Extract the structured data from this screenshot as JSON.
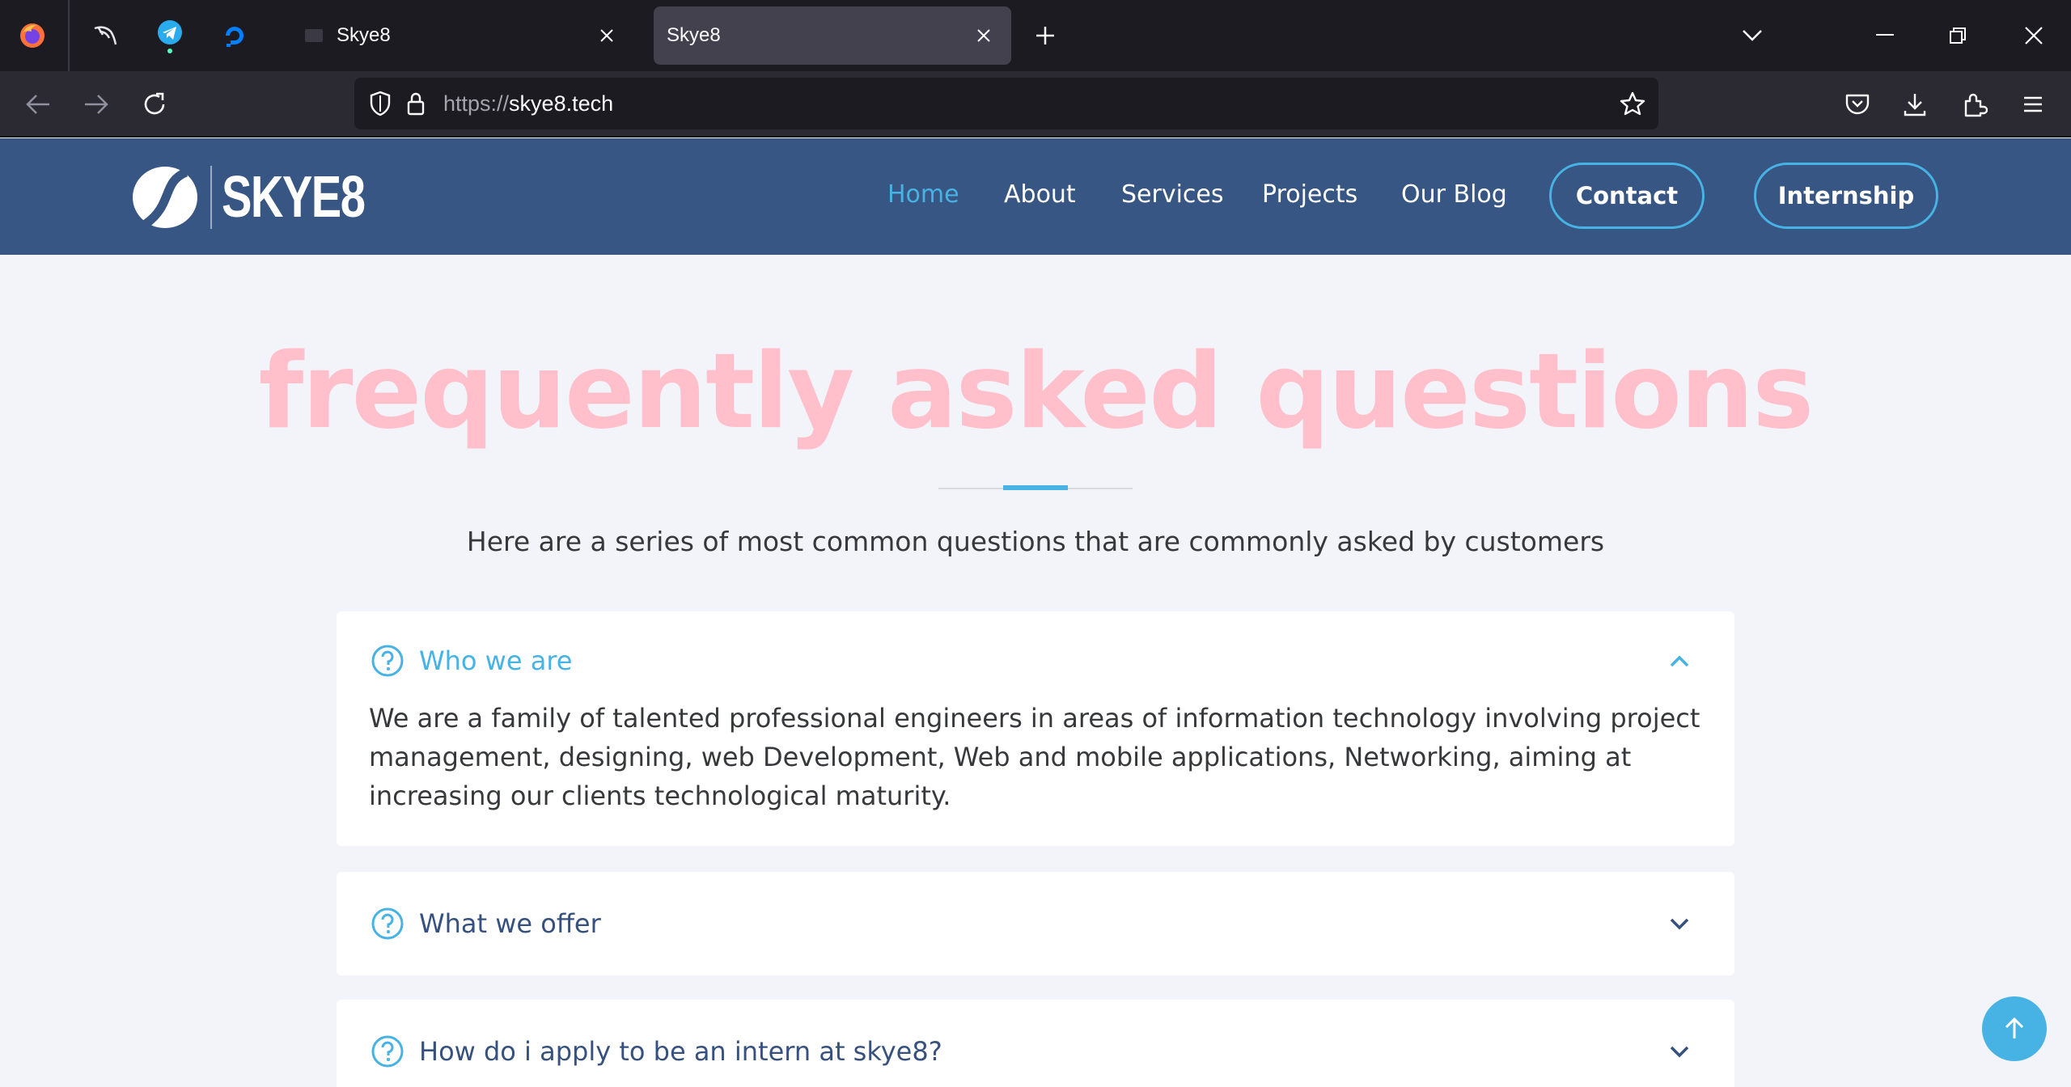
{
  "browser": {
    "tabs": [
      {
        "title": "Skye8",
        "active": false
      },
      {
        "title": "Skye8",
        "active": true
      }
    ],
    "url_protocol": "https://",
    "url_host": "skye8.tech",
    "icons": [
      "firefox-icon",
      "kali-dragon-icon",
      "telegram-icon",
      "digitalocean-icon",
      "new-tab-icon",
      "list-all-tabs-icon",
      "minimize-icon",
      "restore-icon",
      "close-window-icon",
      "back-icon",
      "forward-icon",
      "reload-icon",
      "shield-icon",
      "lock-icon",
      "bookmark-star-icon",
      "pocket-icon",
      "downloads-icon",
      "extensions-icon",
      "app-menu-icon"
    ]
  },
  "site": {
    "logo_text": "SKYE8",
    "nav": {
      "home": "Home",
      "about": "About",
      "services": "Services",
      "projects": "Projects",
      "blog": "Our Blog",
      "contact": "Contact",
      "internship": "Internship"
    },
    "colors": {
      "header": "#375683",
      "accent": "#47b2e4",
      "heading": "#ffc0cb"
    }
  },
  "faq": {
    "heading": "frequently asked questions",
    "subtitle": "Here are a series of most common questions that are commonly asked by customers",
    "items": [
      {
        "question": "Who we are",
        "expanded": true,
        "answer": "We are a family of talented professional engineers in areas of information technology involving project management, designing, web Development, Web and mobile applications, Networking, aiming at increasing our clients technological maturity."
      },
      {
        "question": "What we offer",
        "expanded": false
      },
      {
        "question": "How do i apply to be an intern at skye8?",
        "expanded": false
      }
    ]
  }
}
